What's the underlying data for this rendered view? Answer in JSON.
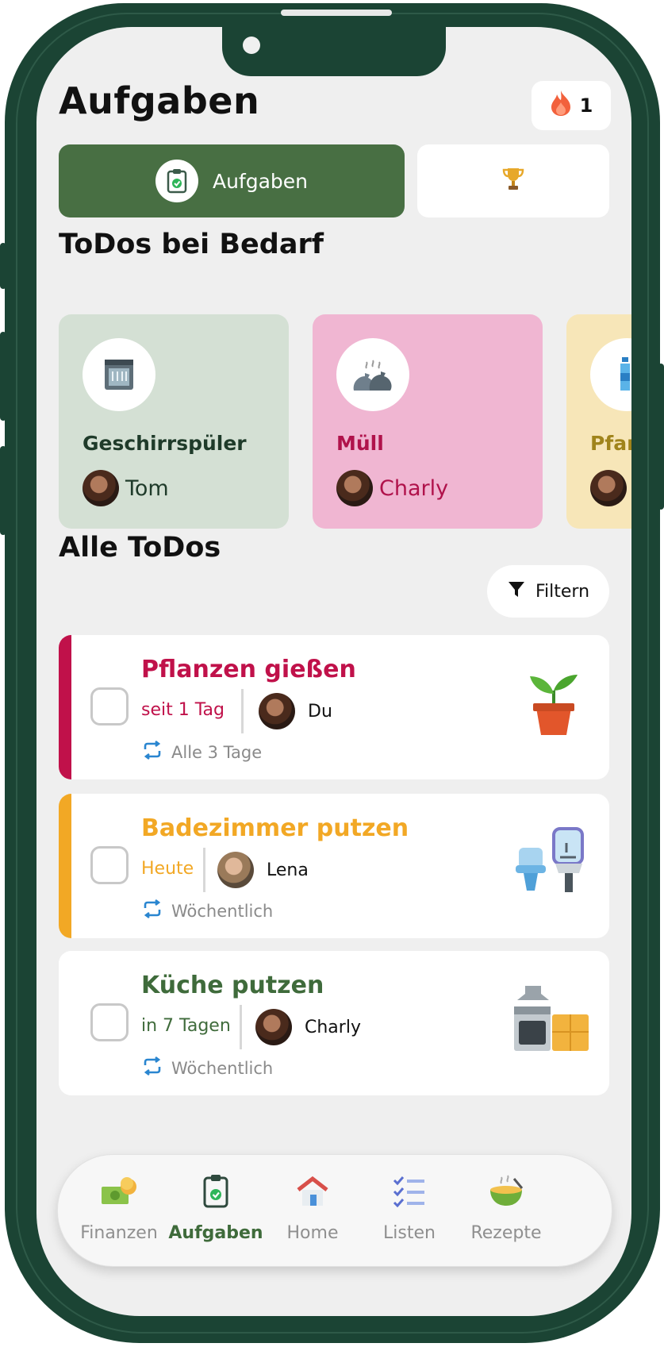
{
  "header": {
    "title": "Aufgaben",
    "streak_count": "1",
    "streak_icon": "flame-icon"
  },
  "segments": {
    "active_label": "Aufgaben",
    "active_icon": "clipboard-check-icon",
    "inactive_icon": "trophy-icon"
  },
  "on_demand": {
    "heading": "ToDos bei Bedarf",
    "cards": [
      {
        "name": "Geschirrspüler",
        "user": "Tom",
        "icon": "dishwasher-icon",
        "bg": "#d4e0d4",
        "text_color": "#1f3b2a",
        "user_color": "#1f3b2a"
      },
      {
        "name": "Müll",
        "user": "Charly",
        "icon": "trash-bags-icon",
        "bg": "#f0b6d2",
        "text_color": "#b0124b",
        "user_color": "#b0124b"
      },
      {
        "name": "Pfand",
        "user": "",
        "icon": "bottles-icon",
        "bg": "#f7e6b8",
        "text_color": "#a0841b",
        "user_color": "#a0841b"
      }
    ]
  },
  "all_todos": {
    "heading": "Alle ToDos",
    "filter_label": "Filtern",
    "tasks": [
      {
        "title": "Pflanzen gießen",
        "due": "seit 1 Tag",
        "user": "Du",
        "repeat": "Alle 3 Tage",
        "color": "#c0114a",
        "illustration": "potted-plant-icon"
      },
      {
        "title": "Badezimmer putzen",
        "due": "Heute",
        "user": "Lena",
        "repeat": "Wöchentlich",
        "color": "#f2a825",
        "illustration": "bathroom-icon"
      },
      {
        "title": "Küche putzen",
        "due": "in 7 Tagen",
        "user": "Charly",
        "repeat": "Wöchentlich",
        "color": "#3f6b3b",
        "illustration": "kitchen-icon"
      }
    ]
  },
  "bottom_nav": {
    "items": [
      {
        "label": "Finanzen",
        "icon": "money-icon"
      },
      {
        "label": "Aufgaben",
        "icon": "clipboard-icon",
        "active": true
      },
      {
        "label": "Home",
        "icon": "house-icon"
      },
      {
        "label": "Listen",
        "icon": "checklist-icon"
      },
      {
        "label": "Rezepte",
        "icon": "bowl-icon"
      }
    ]
  },
  "colors": {
    "accent": "#486f43",
    "frame": "#1b4434",
    "background": "#efefef"
  }
}
